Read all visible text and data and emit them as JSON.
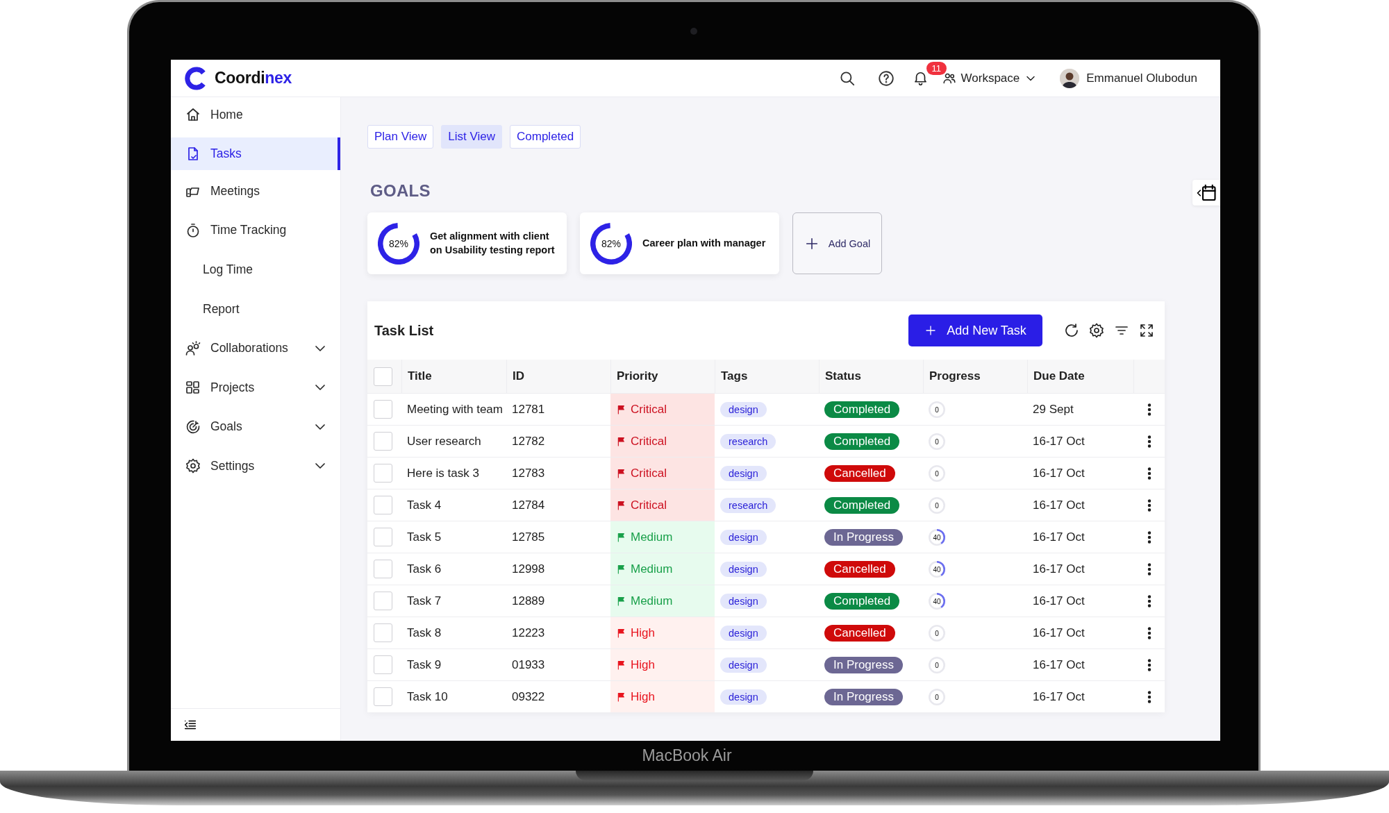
{
  "device": {
    "label": "MacBook Air"
  },
  "header": {
    "brand": [
      "Coordi",
      "nex"
    ],
    "notifications": "11",
    "workspace": "Workspace",
    "user": "Emmanuel Olubodun"
  },
  "sidebar": {
    "items": [
      {
        "label": "Home",
        "kind": "item",
        "selected": false
      },
      {
        "label": "Tasks",
        "kind": "item",
        "selected": true
      },
      {
        "label": "Meetings",
        "kind": "item",
        "selected": false
      },
      {
        "label": "Time Tracking",
        "kind": "item",
        "selected": false
      },
      {
        "label": "Log Time",
        "kind": "subitem",
        "selected": false
      },
      {
        "label": "Report",
        "kind": "subitem",
        "selected": false
      },
      {
        "label": "Collaborations",
        "kind": "group",
        "selected": false,
        "expanded": false
      },
      {
        "label": "Projects",
        "kind": "group",
        "selected": false,
        "expanded": false
      },
      {
        "label": "Goals",
        "kind": "group",
        "selected": false,
        "expanded": false
      },
      {
        "label": "Settings",
        "kind": "group",
        "selected": false,
        "expanded": false
      }
    ]
  },
  "view_tabs": [
    {
      "label": "Plan View",
      "selected": false
    },
    {
      "label": "List View",
      "selected": true
    },
    {
      "label": "Completed",
      "selected": false
    }
  ],
  "goals": {
    "title": "GOALS",
    "cards": [
      {
        "text": "Get alignment with client on Usability testing report",
        "level": 0.82,
        "reading": "82%"
      },
      {
        "text": "Career plan with manager",
        "level": 0.82,
        "reading": "82%"
      }
    ],
    "add_label": "Add Goal"
  },
  "task_list": {
    "title": "Task List",
    "add_button": "Add New Task",
    "select_all_checked": false,
    "columns": [
      "Title",
      "ID",
      "Priority",
      "Tags",
      "Status",
      "Progress",
      "Due Date"
    ],
    "rows": [
      {
        "checked": false,
        "title": "Meeting with team",
        "id": "12781",
        "priority": {
          "kind": "critical",
          "label": "Critical"
        },
        "tag": "design",
        "status": {
          "kind": "completed",
          "label": "Completed"
        },
        "progress": {
          "level": 0,
          "reading": "0"
        },
        "due": "29 Sept"
      },
      {
        "checked": false,
        "title": "User research",
        "id": "12782",
        "priority": {
          "kind": "critical",
          "label": "Critical"
        },
        "tag": "research",
        "status": {
          "kind": "completed",
          "label": "Completed"
        },
        "progress": {
          "level": 0,
          "reading": "0"
        },
        "due": "16-17 Oct"
      },
      {
        "checked": false,
        "title": "Here is task 3",
        "id": "12783",
        "priority": {
          "kind": "critical",
          "label": "Critical"
        },
        "tag": "design",
        "status": {
          "kind": "cancelled",
          "label": "Cancelled"
        },
        "progress": {
          "level": 0,
          "reading": "0"
        },
        "due": "16-17 Oct"
      },
      {
        "checked": false,
        "title": "Task 4",
        "id": "12784",
        "priority": {
          "kind": "critical",
          "label": "Critical"
        },
        "tag": "research",
        "status": {
          "kind": "completed",
          "label": "Completed"
        },
        "progress": {
          "level": 0,
          "reading": "0"
        },
        "due": "16-17 Oct"
      },
      {
        "checked": false,
        "title": "Task 5",
        "id": "12785",
        "priority": {
          "kind": "medium",
          "label": "Medium"
        },
        "tag": "design",
        "status": {
          "kind": "in_progress",
          "label": "In Progress"
        },
        "progress": {
          "level": 0.4,
          "reading": "40"
        },
        "due": "16-17 Oct"
      },
      {
        "checked": false,
        "title": "Task 6",
        "id": "12998",
        "priority": {
          "kind": "medium",
          "label": "Medium"
        },
        "tag": "design",
        "status": {
          "kind": "cancelled",
          "label": "Cancelled"
        },
        "progress": {
          "level": 0.4,
          "reading": "40"
        },
        "due": "16-17 Oct"
      },
      {
        "checked": false,
        "title": "Task 7",
        "id": "12889",
        "priority": {
          "kind": "medium",
          "label": "Medium"
        },
        "tag": "design",
        "status": {
          "kind": "completed",
          "label": "Completed"
        },
        "progress": {
          "level": 0.4,
          "reading": "40"
        },
        "due": "16-17 Oct"
      },
      {
        "checked": false,
        "title": "Task 8",
        "id": "12223",
        "priority": {
          "kind": "high",
          "label": "High"
        },
        "tag": "design",
        "status": {
          "kind": "cancelled",
          "label": "Cancelled"
        },
        "progress": {
          "level": 0,
          "reading": "0"
        },
        "due": "16-17 Oct"
      },
      {
        "checked": false,
        "title": "Task 9",
        "id": "01933",
        "priority": {
          "kind": "high",
          "label": "High"
        },
        "tag": "design",
        "status": {
          "kind": "in_progress",
          "label": "In Progress"
        },
        "progress": {
          "level": 0,
          "reading": "0"
        },
        "due": "16-17 Oct"
      },
      {
        "checked": false,
        "title": "Task 10",
        "id": "09322",
        "priority": {
          "kind": "high",
          "label": "High"
        },
        "tag": "design",
        "status": {
          "kind": "in_progress",
          "label": "In Progress"
        },
        "progress": {
          "level": 0,
          "reading": "0"
        },
        "due": "16-17 Oct"
      }
    ]
  }
}
